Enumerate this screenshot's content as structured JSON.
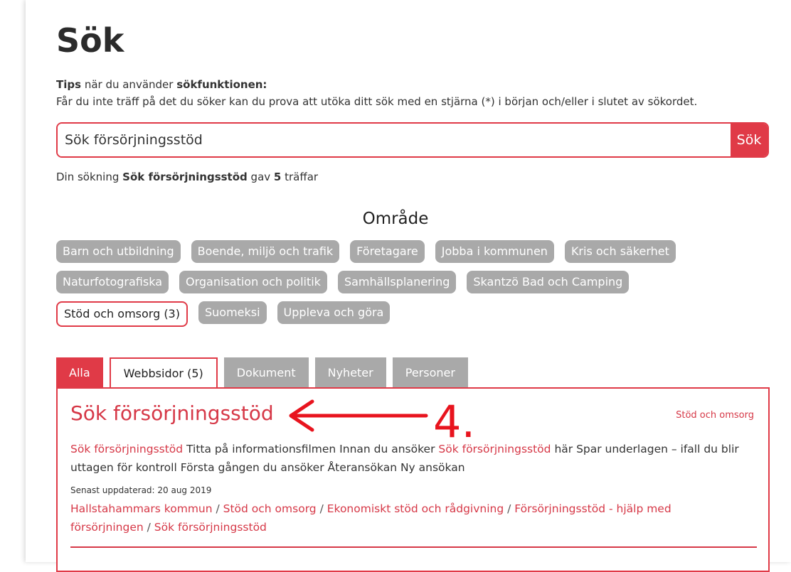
{
  "page": {
    "title": "Sök",
    "tips_label": "Tips",
    "tips_mid": " när du använder ",
    "tips_bold": "sökfunktionen:",
    "tips_text": "Får du inte träff på det du söker kan du prova att utöka ditt sök med en stjärna (*) i början och/eller i slutet av sökordet."
  },
  "search": {
    "value": "Sök försörjningsstöd",
    "button_label": "Sök"
  },
  "result_info": {
    "prefix": "Din sökning ",
    "query": "Sök försörjningsstöd",
    "mid": " gav ",
    "count": "5",
    "suffix": " träffar"
  },
  "area": {
    "title": "Område",
    "rows": [
      [
        "Barn och utbildning",
        "Boende, miljö och trafik",
        "Företagare",
        "Jobba i kommunen",
        "Kris och säkerhet"
      ],
      [
        "Naturfotografiska",
        "Organisation och politik",
        "Samhällsplanering",
        "Skantzö Bad och Camping"
      ],
      [
        "Stöd och omsorg (3)",
        "Suomeksi",
        "Uppleva och göra"
      ]
    ],
    "active": "Stöd och omsorg (3)"
  },
  "tabs": [
    {
      "label": "Alla",
      "state": "active"
    },
    {
      "label": "Webbsidor (5)",
      "state": "outlined"
    },
    {
      "label": "Dokument",
      "state": "inactive"
    },
    {
      "label": "Nyheter",
      "state": "inactive"
    },
    {
      "label": "Personer",
      "state": "inactive"
    }
  ],
  "result": {
    "title": "Sök försörjningsstöd",
    "category": "Stöd och omsorg",
    "annotation": "4.",
    "snippet_hl1": "Sök försörjningsstöd",
    "snippet_mid": " Titta på informationsfilmen Innan du ansöker ",
    "snippet_hl2": "Sök försörjningsstöd",
    "snippet_rest": " här Spar underlagen – ifall du blir uttagen för kontroll Första gången du ansöker Återansökan Ny ansökan",
    "updated": "Senast uppdaterad: 20 aug 2019",
    "breadcrumbs": [
      "Hallstahammars kommun",
      "Stöd och omsorg",
      "Ekonomiskt stöd och rådgivning",
      "Försörjningsstöd - hjälp med försörjningen",
      "Sök försörjningsstöd"
    ]
  },
  "colors": {
    "accent": "#e03a47",
    "chip": "#a9a9a9",
    "annotation": "#e8141e"
  }
}
